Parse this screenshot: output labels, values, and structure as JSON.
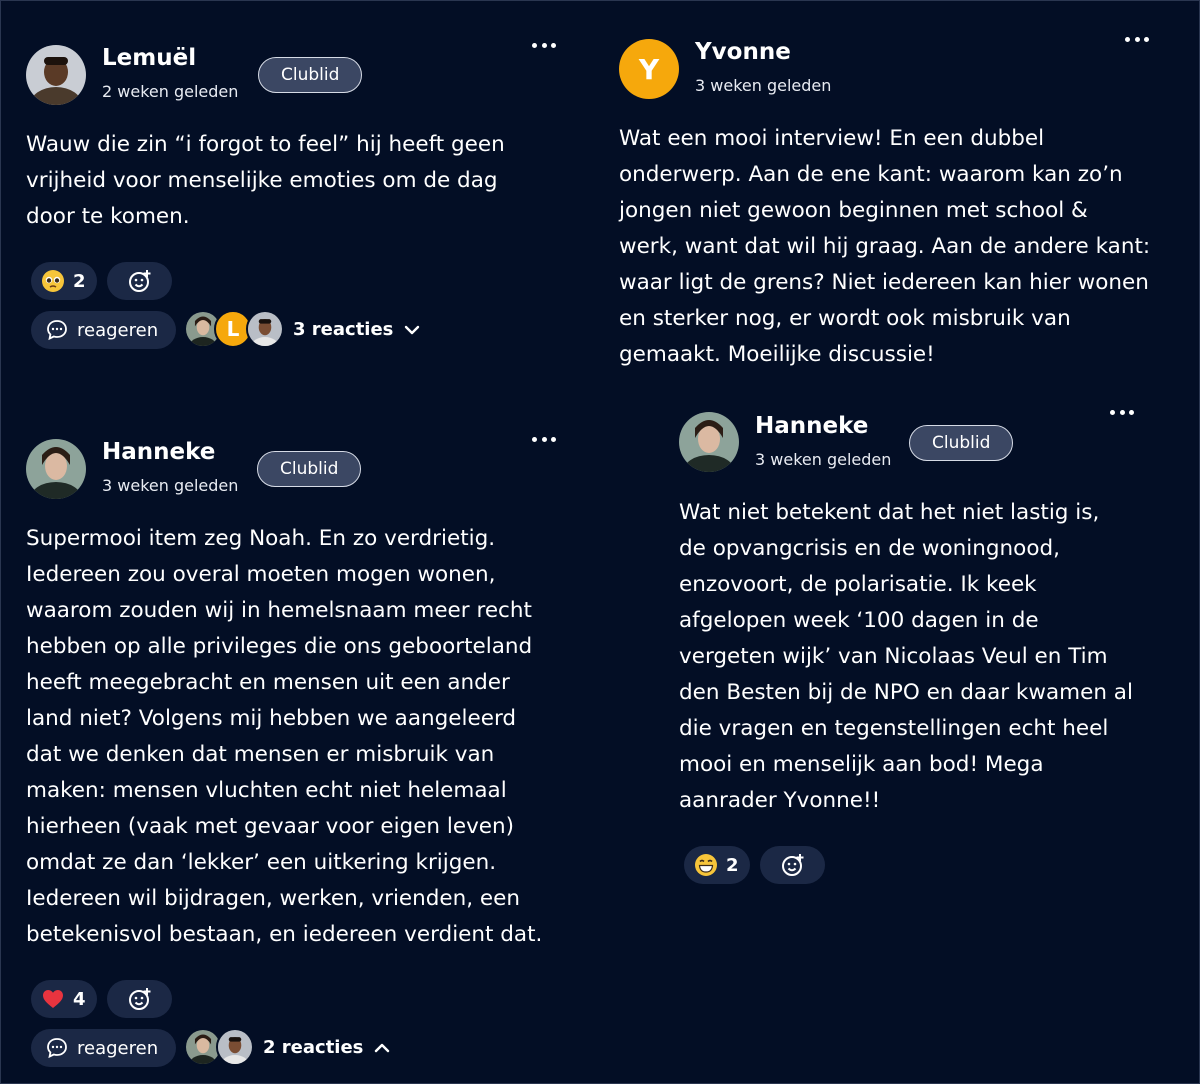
{
  "comments": [
    {
      "author": "Lemuël",
      "time": "2 weken geleden",
      "badge": "Clublid",
      "lines": [
        "Wauw die zin “i forgot to feel” hij heeft geen",
        "vrijheid voor menselijke emoties om de dag",
        "door te komen."
      ],
      "reaction": {
        "emoji": "pleading-face",
        "count": "2"
      },
      "reply_label": "reageren",
      "replies_label": "3 reacties",
      "replies_avatars": [
        "photo",
        "L",
        "photo"
      ]
    },
    {
      "author": "Hanneke",
      "time": "3 weken geleden",
      "badge": "Clublid",
      "lines": [
        "Supermooi item zeg Noah. En zo verdrietig.",
        "Iedereen zou overal moeten mogen wonen,",
        "waarom zouden wij in hemelsnaam meer recht",
        "hebben op alle privileges die ons geboorteland",
        "heeft meegebracht en mensen uit een ander",
        "land niet? Volgens mij hebben we aangeleerd",
        "dat we denken dat mensen er misbruik van",
        "maken: mensen vluchten echt niet helemaal",
        "hierheen (vaak met gevaar voor eigen leven)",
        "omdat ze dan ‘lekker’ een uitkering krijgen.",
        "Iedereen wil bijdragen, werken, vrienden, een",
        "betekenisvol bestaan, en iedereen verdient dat."
      ],
      "reaction": {
        "emoji": "red-heart",
        "count": "4"
      },
      "reply_label": "reageren",
      "replies_label": "2 reacties"
    },
    {
      "author": "Yvonne",
      "avatar_letter": "Y",
      "time": "3 weken geleden",
      "lines": [
        "Wat een mooi interview! En een dubbel",
        "onderwerp. Aan de ene kant: waarom kan zo’n",
        "jongen niet gewoon beginnen met school &",
        "werk, want dat wil hij graag. Aan de andere kant:",
        "waar ligt de grens? Niet iedereen kan hier wonen",
        "en sterker nog, er wordt ook misbruik van",
        "gemaakt. Moeilijke discussie!"
      ]
    },
    {
      "author": "Hanneke",
      "time": "3 weken geleden",
      "badge": "Clublid",
      "lines": [
        "Wat niet betekent dat het niet lastig is,",
        "de opvangcrisis en de woningnood,",
        "enzovoort, de polarisatie. Ik keek",
        "afgelopen week ‘100 dagen in de",
        "vergeten wijk’ van Nicolaas Veul en Tim",
        "den Besten bij de NPO en daar kwamen al",
        "die vragen en tegenstellingen echt heel",
        "mooi en menselijk aan bod! Mega",
        "aanrader Yvonne!!"
      ],
      "reaction": {
        "emoji": "grinning-face",
        "count": "2"
      }
    }
  ],
  "colors": {
    "background": "#030e25",
    "pill": "#1b2845",
    "badge": "#3b4763",
    "avatar_yellow": "#f6a80c"
  }
}
